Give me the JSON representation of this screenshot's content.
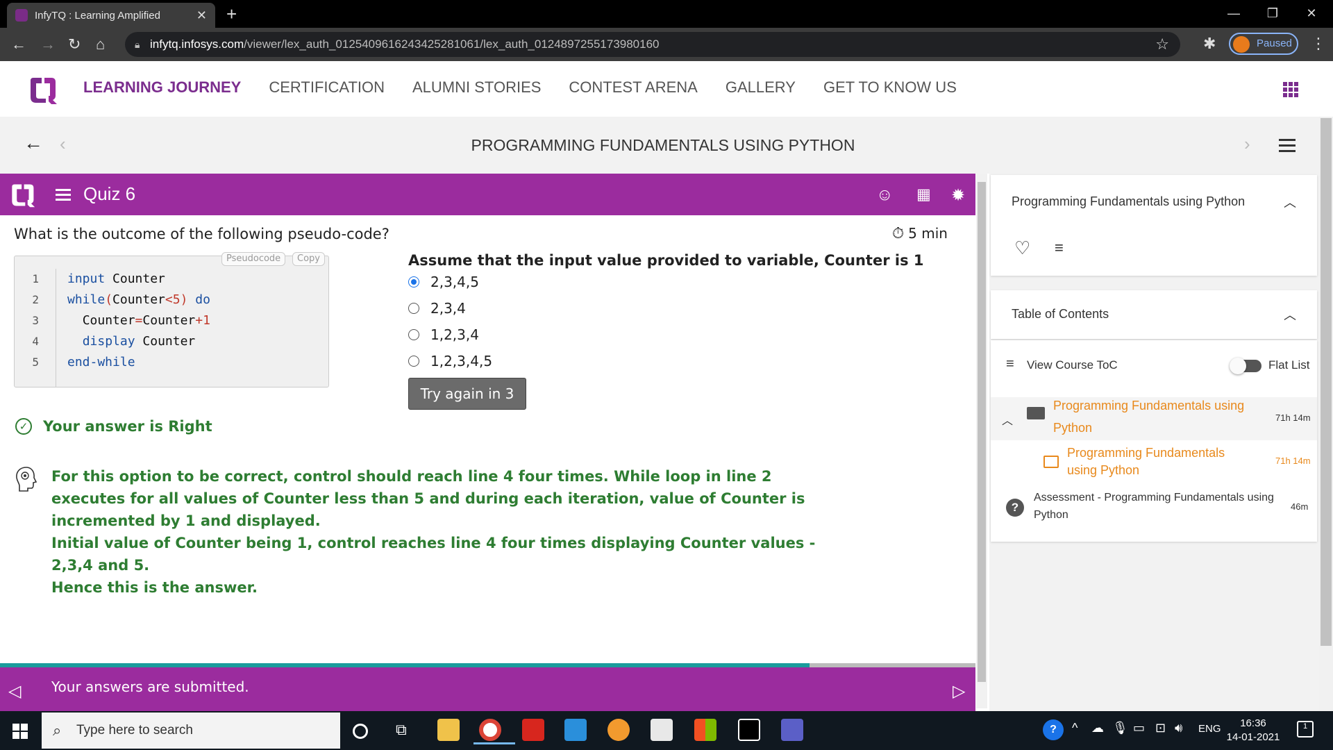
{
  "browser": {
    "tab_title": "InfyTQ : Learning Amplified",
    "url_host": "infytq.infosys.com",
    "url_path": "/viewer/lex_auth_0125409616243425281061/lex_auth_0124897255173980160",
    "profile_label": "Paused"
  },
  "site": {
    "nav": [
      {
        "label": "LEARNING JOURNEY"
      },
      {
        "label": "CERTIFICATION"
      },
      {
        "label": "ALUMNI STORIES"
      },
      {
        "label": "CONTEST ARENA"
      },
      {
        "label": "GALLERY"
      },
      {
        "label": "GET TO KNOW US"
      }
    ],
    "accent": "#7b2d8e"
  },
  "course": {
    "title": "PROGRAMMING FUNDAMENTALS USING PYTHON"
  },
  "quiz": {
    "title": "Quiz 6",
    "header_color": "#9b2c9e",
    "question": "What is the outcome of the following pseudo-code?",
    "timer": "5 min",
    "code_tabs": [
      "Pseudocode",
      "Copy"
    ],
    "code_lines": [
      {
        "no": "1",
        "text": "input Counter"
      },
      {
        "no": "2",
        "text": "while(Counter<5) do"
      },
      {
        "no": "3",
        "text": "  Counter=Counter+1"
      },
      {
        "no": "4",
        "text": "  display Counter"
      },
      {
        "no": "5",
        "text": "end-while"
      }
    ],
    "assumption": "Assume that the input value provided to variable, Counter is 1",
    "options": [
      {
        "label": "2,3,4,5",
        "selected": true
      },
      {
        "label": "2,3,4",
        "selected": false
      },
      {
        "label": "1,2,3,4",
        "selected": false
      },
      {
        "label": "1,2,3,4,5",
        "selected": false
      }
    ],
    "try_again_label": "Try again in 3",
    "result": "Your answer is Right",
    "explanation": [
      "For this option to be correct, control should reach line 4 four times. While loop in line 2 executes for all values of Counter less than 5 and during each iteration, value of Counter is incremented by 1 and displayed.",
      "Initial value of Counter being 1, control reaches line 4 four times displaying Counter values - 2,3,4 and 5.",
      "Hence this is the answer."
    ],
    "progress": 0.83,
    "submitted_text": "Your answers are submitted."
  },
  "panel": {
    "course_card_title": "Programming Fundamentals using Python",
    "toc_title": "Table of Contents",
    "view_toc_label": "View Course ToC",
    "flat_list_label": "Flat List",
    "items": [
      {
        "title": "Programming Fundamentals using Python",
        "time": "71h 14m"
      },
      {
        "title": "Programming Fundamentals using Python",
        "time": "71h 14m"
      },
      {
        "title": "Assessment - Programming Fundamentals using Python",
        "time": "46m"
      }
    ]
  },
  "taskbar": {
    "search_placeholder": "Type here to search",
    "lang": "ENG",
    "time": "16:36",
    "date": "14-01-2021",
    "notifications": "1"
  }
}
